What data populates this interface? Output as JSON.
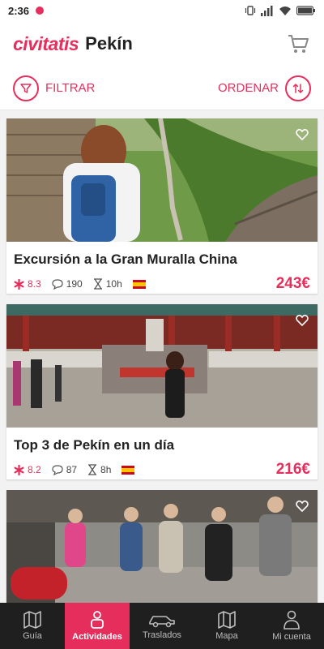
{
  "status": {
    "time": "2:36"
  },
  "header": {
    "brand": "civitatis",
    "city": "Pekín"
  },
  "toolbar": {
    "filter_label": "FILTRAR",
    "order_label": "ORDENAR"
  },
  "cards": [
    {
      "title": "Excursión a la Gran Muralla China",
      "rating": "8.3",
      "reviews": "190",
      "duration": "10h",
      "price": "243€"
    },
    {
      "title": "Top 3 de Pekín en un día",
      "rating": "8.2",
      "reviews": "87",
      "duration": "8h",
      "price": "216€"
    },
    {
      "title": "",
      "rating": "",
      "reviews": "",
      "duration": "",
      "price": ""
    }
  ],
  "nav": [
    {
      "label": "Guía",
      "icon": "map-icon"
    },
    {
      "label": "Actividades",
      "icon": "person-icon"
    },
    {
      "label": "Traslados",
      "icon": "car-icon"
    },
    {
      "label": "Mapa",
      "icon": "folded-map-icon"
    },
    {
      "label": "Mi cuenta",
      "icon": "user-icon"
    }
  ],
  "colors": {
    "accent": "#e62e5c",
    "nav_bg": "#1f1f1f"
  }
}
